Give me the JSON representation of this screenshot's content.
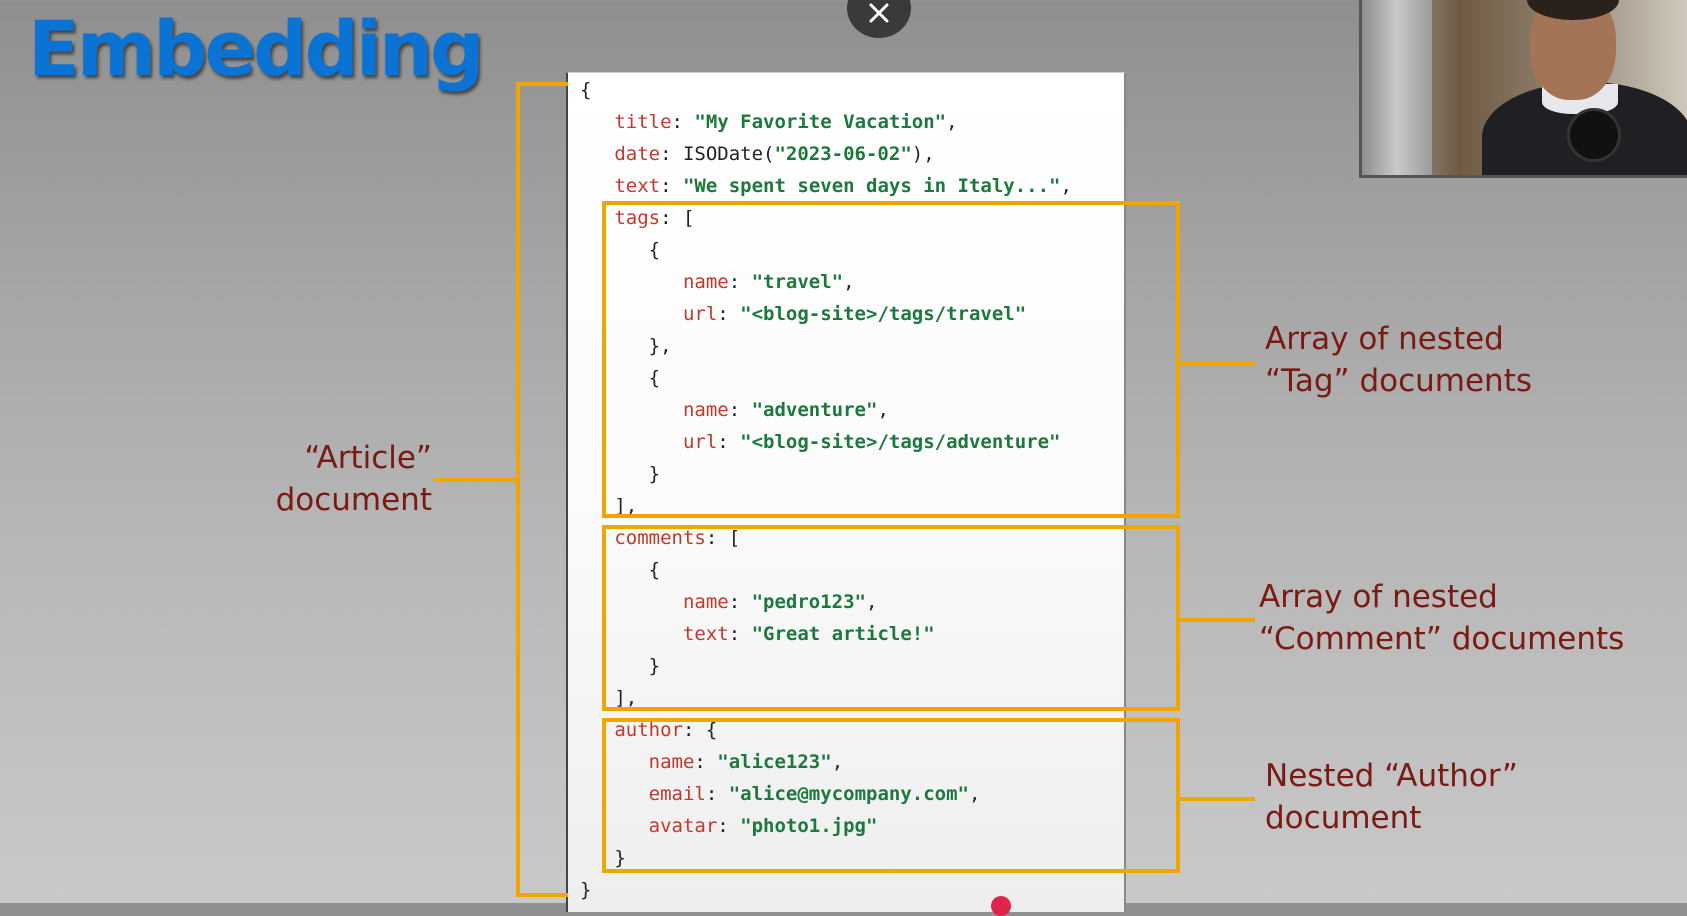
{
  "slide": {
    "title": "Embedding"
  },
  "code_lines": [
    [
      [
        "p",
        "{"
      ]
    ],
    [
      [
        "p",
        "   "
      ],
      [
        "k",
        "title"
      ],
      [
        "p",
        ": "
      ],
      [
        "s",
        "\"My Favorite Vacation\""
      ],
      [
        "p",
        ","
      ]
    ],
    [
      [
        "p",
        "   "
      ],
      [
        "k",
        "date"
      ],
      [
        "p",
        ": ISODate("
      ],
      [
        "s",
        "\"2023-06-02\""
      ],
      [
        "p",
        "),"
      ]
    ],
    [
      [
        "p",
        "   "
      ],
      [
        "k",
        "text"
      ],
      [
        "p",
        ": "
      ],
      [
        "s",
        "\"We spent seven days in Italy...\""
      ],
      [
        "p",
        ","
      ]
    ],
    [
      [
        "p",
        "   "
      ],
      [
        "k",
        "tags"
      ],
      [
        "p",
        ": ["
      ]
    ],
    [
      [
        "p",
        "      {"
      ]
    ],
    [
      [
        "p",
        "         "
      ],
      [
        "k",
        "name"
      ],
      [
        "p",
        ": "
      ],
      [
        "s",
        "\"travel\""
      ],
      [
        "p",
        ","
      ]
    ],
    [
      [
        "p",
        "         "
      ],
      [
        "k",
        "url"
      ],
      [
        "p",
        ": "
      ],
      [
        "s",
        "\"<blog-site>/tags/travel\""
      ]
    ],
    [
      [
        "p",
        "      },"
      ]
    ],
    [
      [
        "p",
        "      {"
      ]
    ],
    [
      [
        "p",
        "         "
      ],
      [
        "k",
        "name"
      ],
      [
        "p",
        ": "
      ],
      [
        "s",
        "\"adventure\""
      ],
      [
        "p",
        ","
      ]
    ],
    [
      [
        "p",
        "         "
      ],
      [
        "k",
        "url"
      ],
      [
        "p",
        ": "
      ],
      [
        "s",
        "\"<blog-site>/tags/adventure\""
      ]
    ],
    [
      [
        "p",
        "      }"
      ]
    ],
    [
      [
        "p",
        "   ],"
      ]
    ],
    [
      [
        "p",
        "   "
      ],
      [
        "k",
        "comments"
      ],
      [
        "p",
        ": ["
      ]
    ],
    [
      [
        "p",
        "      {"
      ]
    ],
    [
      [
        "p",
        "         "
      ],
      [
        "k",
        "name"
      ],
      [
        "p",
        ": "
      ],
      [
        "s",
        "\"pedro123\""
      ],
      [
        "p",
        ","
      ]
    ],
    [
      [
        "p",
        "         "
      ],
      [
        "k",
        "text"
      ],
      [
        "p",
        ": "
      ],
      [
        "s",
        "\"Great article!\""
      ]
    ],
    [
      [
        "p",
        "      }"
      ]
    ],
    [
      [
        "p",
        "   ],"
      ]
    ],
    [
      [
        "p",
        "   "
      ],
      [
        "k",
        "author"
      ],
      [
        "p",
        ": {"
      ]
    ],
    [
      [
        "p",
        "      "
      ],
      [
        "k",
        "name"
      ],
      [
        "p",
        ": "
      ],
      [
        "s",
        "\"alice123\""
      ],
      [
        "p",
        ","
      ]
    ],
    [
      [
        "p",
        "      "
      ],
      [
        "k",
        "email"
      ],
      [
        "p",
        ": "
      ],
      [
        "s",
        "\"alice@mycompany.com\""
      ],
      [
        "p",
        ","
      ]
    ],
    [
      [
        "p",
        "      "
      ],
      [
        "k",
        "avatar"
      ],
      [
        "p",
        ": "
      ],
      [
        "s",
        "\"photo1.jpg\""
      ]
    ],
    [
      [
        "p",
        "   }"
      ]
    ],
    [
      [
        "p",
        "}"
      ]
    ]
  ],
  "annotations": {
    "article_line1": "“Article”",
    "article_line2": "document",
    "tags_line1": "Array of nested",
    "tags_line2": "“Tag” documents",
    "comments_line1": "Array of nested",
    "comments_line2": "“Comment” documents",
    "author_line1": "Nested “Author”",
    "author_line2": "document"
  },
  "colors": {
    "title_blue": "#0a73d4",
    "bracket_orange": "#f0a500",
    "label_red": "#7a1a12",
    "key_red": "#c0392b",
    "string_green": "#1a7a3b"
  },
  "icons": {
    "close": "close-icon"
  }
}
